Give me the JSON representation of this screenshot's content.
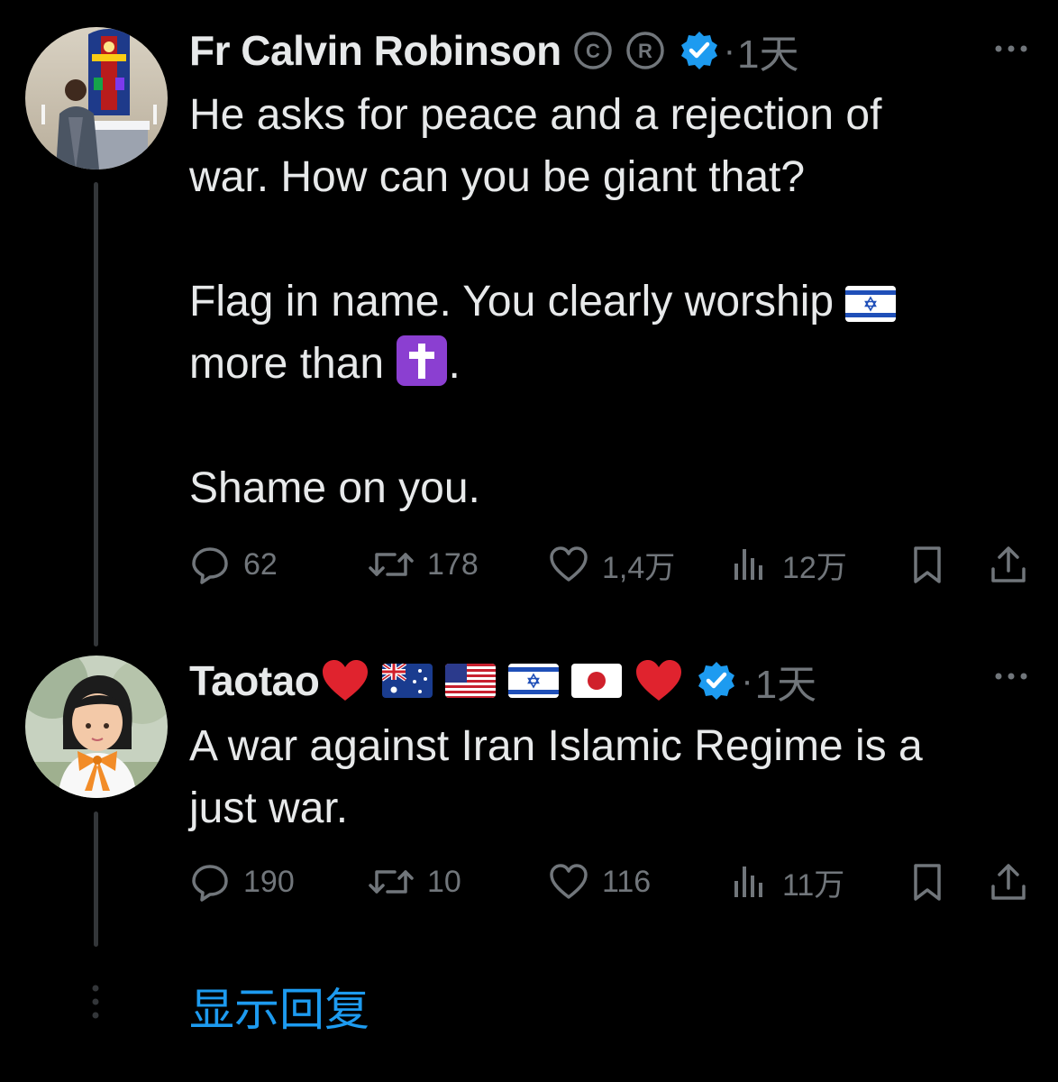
{
  "tweets": [
    {
      "author": "Fr Calvin Robinson",
      "badges": [
        "©",
        "®"
      ],
      "verified": true,
      "separator": "·",
      "time": "1天",
      "text": [
        "He asks for peace and a rejection of",
        "war. How can you be giant that?",
        "",
        "Flag in name. You clearly worship",
        "more than",
        ".",
        "",
        "Shame on you."
      ],
      "stats": {
        "replies": "62",
        "retweets": "178",
        "likes": "1,4万",
        "views": "12万"
      }
    },
    {
      "author": "Taotao",
      "name_emojis": [
        "red-heart",
        "flag-australia",
        "flag-usa",
        "flag-israel",
        "flag-japan",
        "red-heart"
      ],
      "verified": true,
      "separator": "·",
      "time": "1天",
      "text": [
        "A war against Iran Islamic Regime is a",
        "just war."
      ],
      "stats": {
        "replies": "190",
        "retweets": "10",
        "likes": "116",
        "views": "11万"
      }
    }
  ],
  "show_replies": "显示回复",
  "colors": {
    "background": "#000000",
    "text": "#e7e9ea",
    "muted": "#71767b",
    "accent": "#1d9bf0",
    "thread_line": "#333639"
  }
}
